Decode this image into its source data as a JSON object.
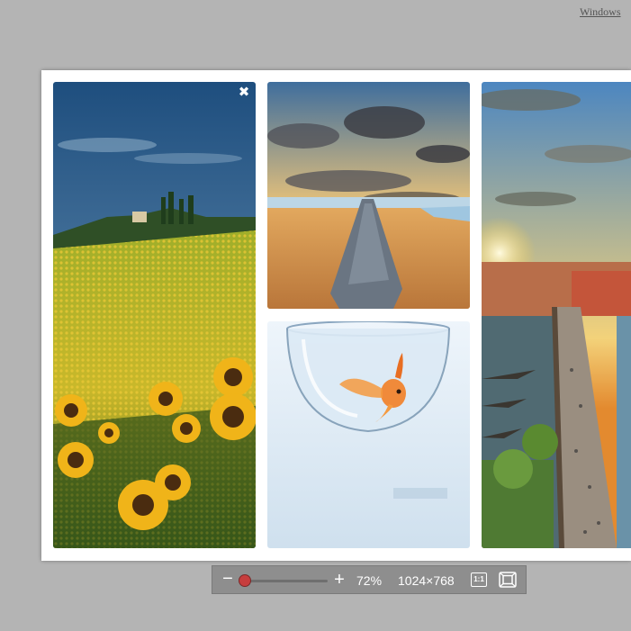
{
  "watermark": "Windows",
  "viewer": {
    "close_icon": "close-icon",
    "images": [
      {
        "subject": "sunflower-field"
      },
      {
        "subject": "beach-sunset"
      },
      {
        "subject": "goldfish-bowl"
      },
      {
        "subject": "city-bridge-sunset"
      }
    ]
  },
  "toolbar": {
    "zoom_out_glyph": "−",
    "zoom_in_glyph": "+",
    "zoom_level": "72%",
    "zoom_fraction": 0.0,
    "resolution": "1024×768",
    "actual_size_glyph": "1:1",
    "actual_size_icon": "actual-size-icon",
    "fit_icon": "fit-window-icon"
  },
  "colors": {
    "background": "#b4b4b4",
    "toolbar": "#8e8e8e",
    "slider_thumb": "#c73e3e"
  }
}
